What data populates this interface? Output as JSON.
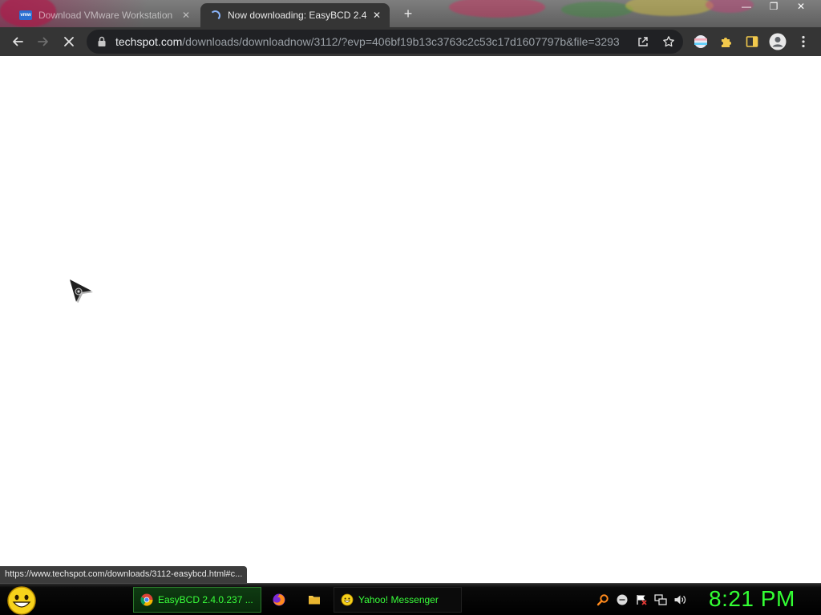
{
  "browser": {
    "tabs": [
      {
        "title": "Download VMware Workstation",
        "favicon": "vmware-icon",
        "active": false,
        "close_label": "✕"
      },
      {
        "title": "Now downloading: EasyBCD 2.4",
        "favicon": "loading-spinner-icon",
        "active": true,
        "close_label": "✕"
      }
    ],
    "new_tab_label": "+",
    "window_controls": {
      "minimize": "—",
      "maximize": "❐",
      "close": "✕"
    },
    "toolbar": {
      "back_icon": "back-arrow-icon",
      "forward_icon": "forward-arrow-icon",
      "stop_icon": "stop-loading-icon",
      "url_host": "techspot.com",
      "url_path": "/downloads/downloadnow/3112/?evp=406bf19b13c3763c2c53c17d1607797b&file=3293",
      "lock_icon": "lock-icon",
      "share_icon": "share-icon",
      "bookmark_icon": "star-icon",
      "extensions": [
        "extension-icon",
        "puzzle-icon"
      ],
      "side_panel_icon": "side-panel-icon",
      "profile_icon": "profile-avatar-icon",
      "menu_icon": "kebab-menu-icon"
    },
    "status_link": "https://www.techspot.com/downloads/3112-easybcd.html#c..."
  },
  "taskbar": {
    "start_icon": "smiley-start-icon",
    "items": [
      {
        "label": "EasyBCD 2.4.0.237 ...",
        "icon": "chrome-icon",
        "active": true
      },
      {
        "label": "",
        "icon": "firefox-icon"
      },
      {
        "label": "",
        "icon": "folder-icon"
      },
      {
        "label": "Yahoo! Messenger",
        "icon": "yahoo-smiley-icon"
      }
    ],
    "tray_icons": [
      "search-icon",
      "messenger-icon",
      "flag-icon",
      "network-icon",
      "volume-icon"
    ],
    "clock": "8:21 PM"
  },
  "colors": {
    "clock": "#33ff33",
    "active_task_border": "#2b7a2c",
    "toolbar": "#353535"
  }
}
